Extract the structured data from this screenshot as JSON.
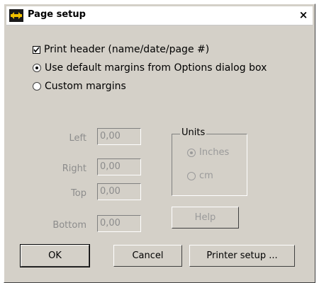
{
  "window": {
    "title": "Page setup",
    "close_label": "×"
  },
  "options": {
    "print_header": {
      "label": "Print header (name/date/page #)",
      "checked": true
    },
    "default_margins": {
      "label": "Use default margins from Options dialog box",
      "selected": true
    },
    "custom_margins": {
      "label": "Custom margins",
      "selected": false
    }
  },
  "margins": {
    "left": {
      "label": "Left",
      "value": "0,00"
    },
    "right": {
      "label": "Right",
      "value": "0,00"
    },
    "top": {
      "label": "Top",
      "value": "0,00"
    },
    "bottom": {
      "label": "Bottom",
      "value": "0,00"
    }
  },
  "units": {
    "title": "Units",
    "inches": {
      "label": "Inches",
      "selected": true
    },
    "cm": {
      "label": "cm",
      "selected": false
    }
  },
  "buttons": {
    "help": "Help",
    "ok": "OK",
    "cancel": "Cancel",
    "printer_setup": "Printer setup ..."
  },
  "colors": {
    "dialog_bg": "#d4d0c8",
    "disabled_text": "#8c8c8c"
  }
}
